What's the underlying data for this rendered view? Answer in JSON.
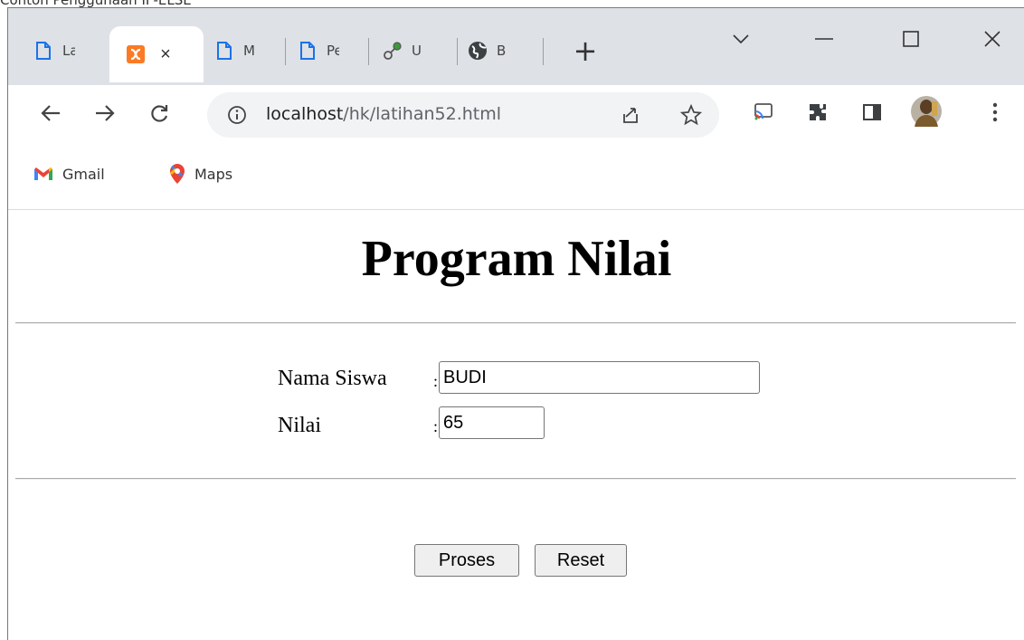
{
  "caption": "Contoh Penggunaan IF-ELSE",
  "tabs": [
    {
      "title": "La",
      "icon": "page-icon"
    },
    {
      "title": "",
      "icon": "xampp-icon",
      "active": true,
      "close": "×"
    },
    {
      "title": "M",
      "icon": "page-icon"
    },
    {
      "title": "Pe",
      "icon": "page-icon"
    },
    {
      "title": "U",
      "icon": "link-icon"
    },
    {
      "title": "B",
      "icon": "globe-icon"
    }
  ],
  "new_tab_label": "+",
  "address": {
    "host": "localhost",
    "path": "/hk/latihan52.html"
  },
  "bookmarks": [
    {
      "label": "Gmail",
      "icon": "gmail-icon"
    },
    {
      "label": "Maps",
      "icon": "maps-icon"
    }
  ],
  "page": {
    "title": "Program Nilai",
    "form": {
      "name_label": "Nama Siswa",
      "name_colon": ":",
      "name_value": "BUDI",
      "score_label": "Nilai",
      "score_colon": ":",
      "score_value": "65"
    },
    "buttons": {
      "submit": "Proses",
      "reset": "Reset"
    }
  },
  "colors": {
    "tabstrip": "#dee1e6",
    "omnibox": "#f1f3f4",
    "xampp": "#fb7a24",
    "gmail_red": "#ea4335",
    "maps_red": "#ea4335"
  }
}
